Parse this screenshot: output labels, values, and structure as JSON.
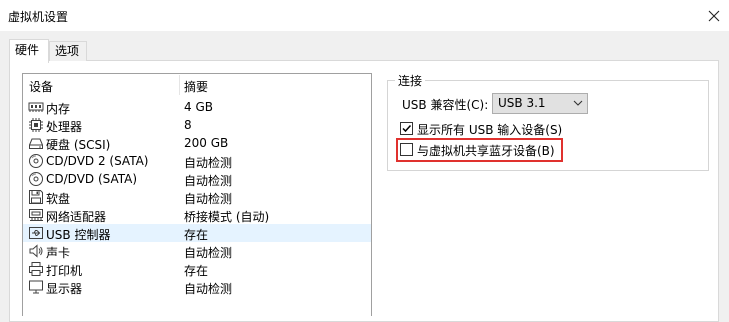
{
  "window": {
    "title": "虚拟机设置"
  },
  "tabs": [
    {
      "label": "硬件"
    },
    {
      "label": "选项"
    }
  ],
  "device_list": {
    "columns": {
      "device": "设备",
      "summary": "摘要"
    },
    "rows": [
      {
        "name": "内存",
        "summary": "4 GB",
        "icon": "memory-icon"
      },
      {
        "name": "处理器",
        "summary": "8",
        "icon": "processor-icon"
      },
      {
        "name": "硬盘 (SCSI)",
        "summary": "200 GB",
        "icon": "hard-disk-icon"
      },
      {
        "name": "CD/DVD 2 (SATA)",
        "summary": "自动检测",
        "icon": "cd-dvd-icon"
      },
      {
        "name": "CD/DVD (SATA)",
        "summary": "自动检测",
        "icon": "cd-dvd-icon"
      },
      {
        "name": "软盘",
        "summary": "自动检测",
        "icon": "floppy-icon"
      },
      {
        "name": "网络适配器",
        "summary": "桥接模式 (自动)",
        "icon": "network-adapter-icon"
      },
      {
        "name": "USB 控制器",
        "summary": "存在",
        "icon": "usb-icon"
      },
      {
        "name": "声卡",
        "summary": "自动检测",
        "icon": "sound-card-icon"
      },
      {
        "name": "打印机",
        "summary": "存在",
        "icon": "printer-icon"
      },
      {
        "name": "显示器",
        "summary": "自动检测",
        "icon": "display-icon"
      }
    ],
    "selected_index": 7
  },
  "connection": {
    "group_label": "连接",
    "compat_label": "USB 兼容性(C):",
    "compat_value": "USB 3.1",
    "show_all_usb": {
      "label": "显示所有 USB 输入设备(S)",
      "checked": true
    },
    "share_bluetooth": {
      "label": "与虚拟机共享蓝牙设备(B)",
      "checked": false
    }
  },
  "colors": {
    "highlight": "#e0312e",
    "selection": "#e5f3ff",
    "icon": "#404040"
  }
}
